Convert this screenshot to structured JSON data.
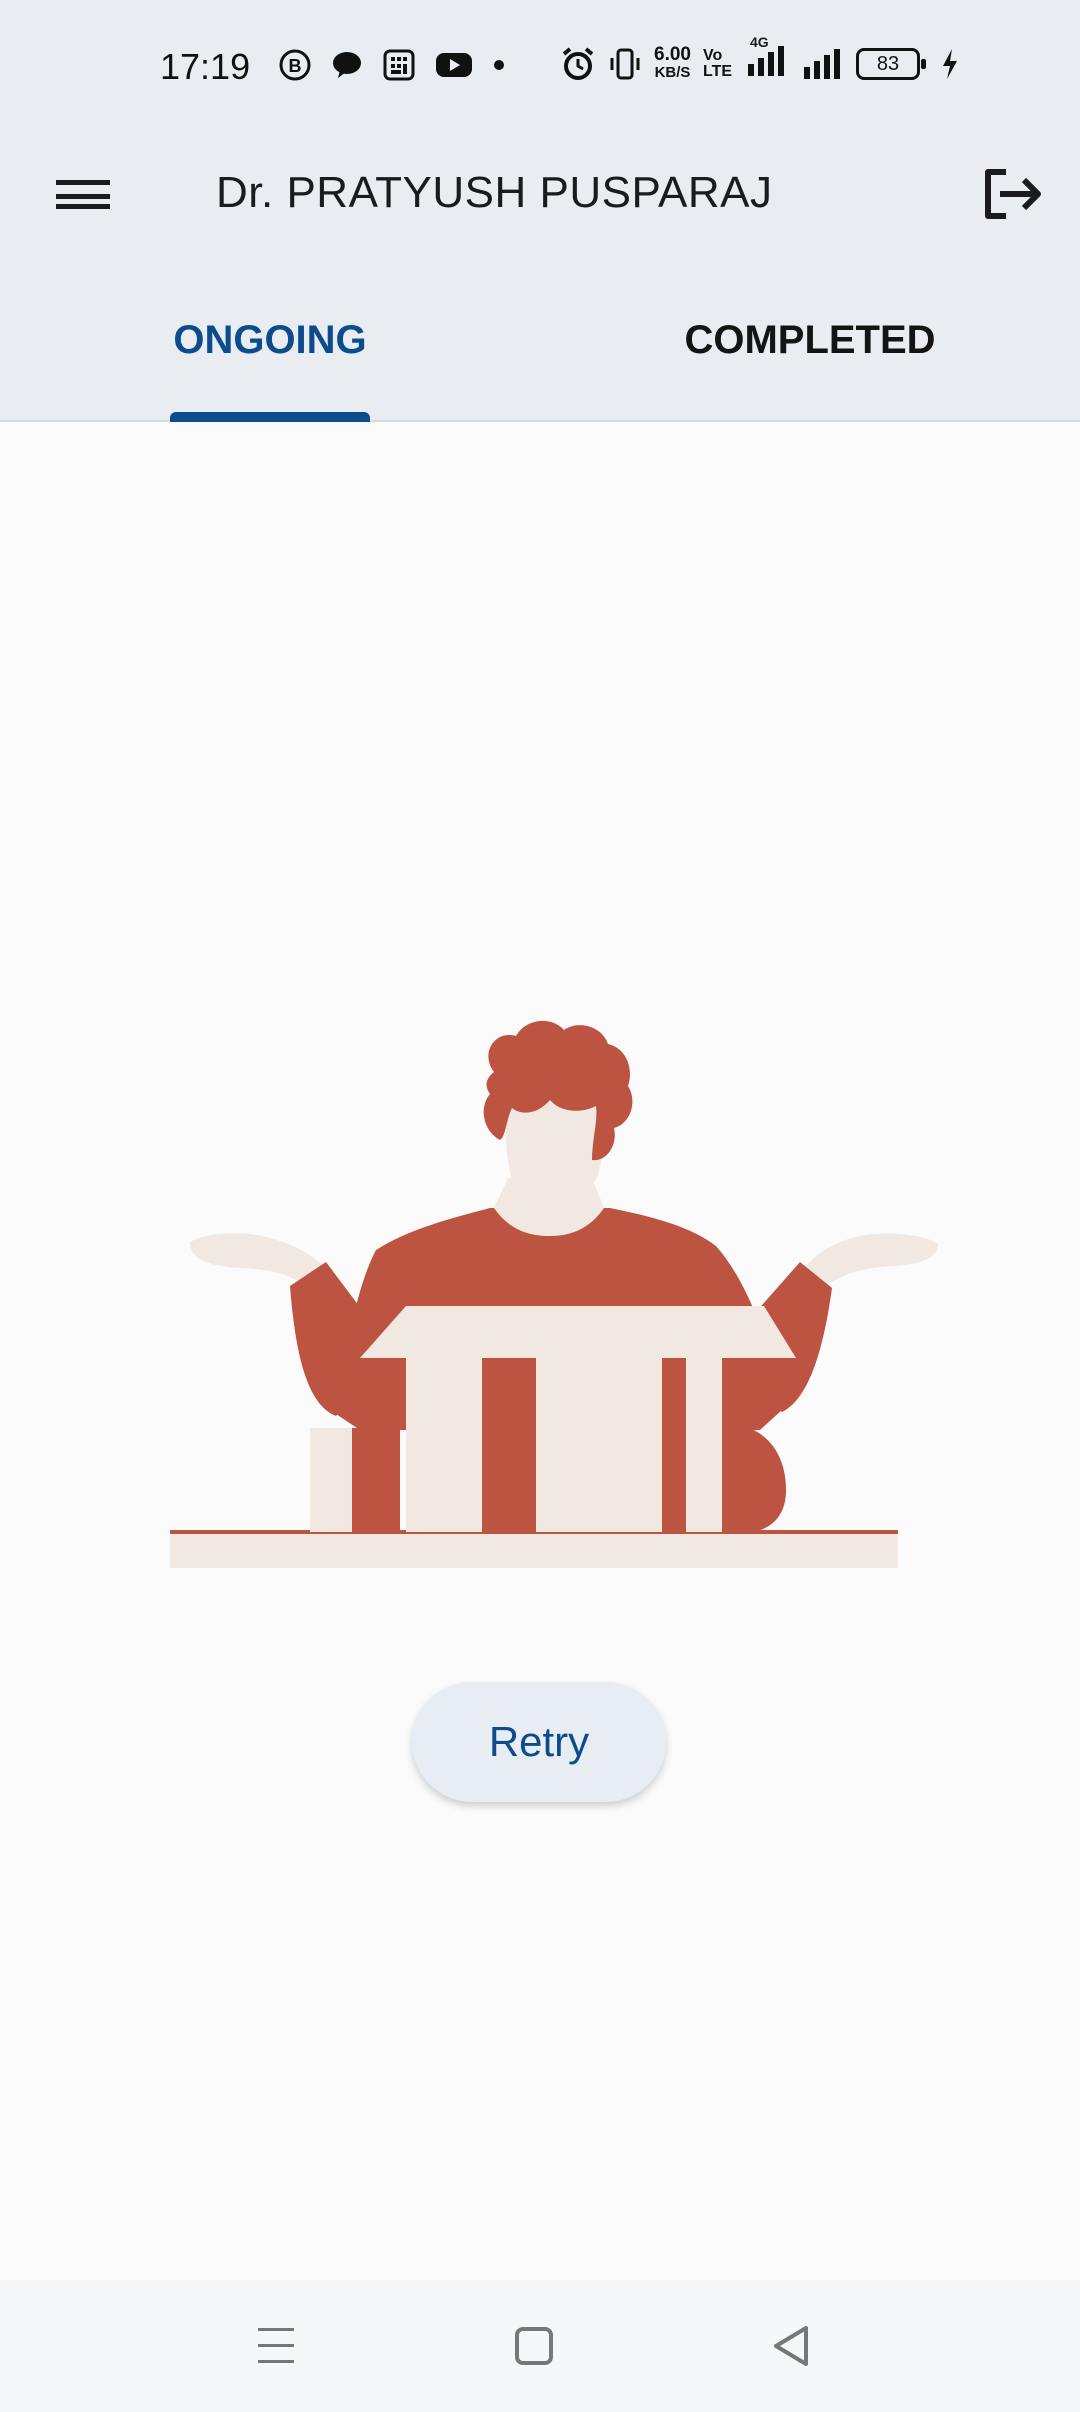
{
  "status_bar": {
    "time": "17:19",
    "net_speed_value": "6.00",
    "net_speed_unit": "KB/S",
    "volte_top": "Vo",
    "volte_bottom": "LTE",
    "network_type": "4G",
    "battery": "83",
    "left_icons": [
      "b-notification-icon",
      "chat-bubble-icon",
      "calculator-icon",
      "youtube-icon",
      "dot-icon"
    ],
    "right_icons": [
      "alarm-icon",
      "vibrate-icon",
      "signal-icon",
      "signal-icon",
      "charging-icon"
    ]
  },
  "app_bar": {
    "title": "Dr. PRATYUSH PUSPARAJ",
    "menu_icon": "hamburger-menu-icon",
    "logout_icon": "logout-icon"
  },
  "tabs": [
    {
      "label": "ONGOING",
      "selected": true
    },
    {
      "label": "COMPLETED",
      "selected": false
    }
  ],
  "colors": {
    "primary": "#0d4c8c",
    "illustration_accent": "#bd5442",
    "illustration_light": "#f2e8e2",
    "header_bg": "#e9edf1"
  },
  "content": {
    "illustration": "empty-box-shrugging-person",
    "retry_label": "Retry"
  },
  "nav_bar": {
    "icons": [
      "recent-apps-icon",
      "home-icon",
      "back-icon"
    ]
  }
}
